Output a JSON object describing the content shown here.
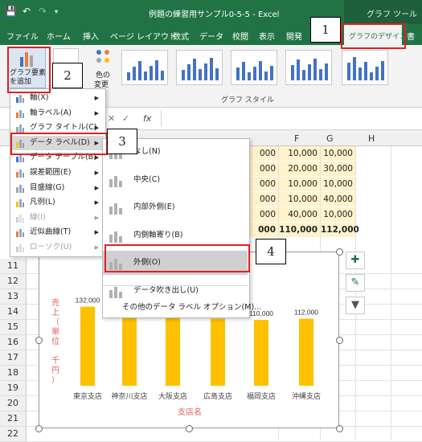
{
  "window": {
    "title": "例題の練習用サンプル0-5-5  -  Excel",
    "context_title": "グラフ ツール"
  },
  "ribbon": {
    "tabs": [
      "ファイル",
      "ホーム",
      "挿入",
      "ページ レイアウト",
      "数式",
      "データ",
      "校閲",
      "表示",
      "開発"
    ],
    "active_tab": "グラフのデザイン",
    "cut_tab": "書",
    "add_element_label_1": "グラフ要素",
    "add_element_label_2": "を追加",
    "color_label_1": "色の",
    "color_label_2": "変更",
    "group_label": "グラフ スタイル"
  },
  "formula_bar": {
    "fx": "fx"
  },
  "columns": [
    "F",
    "G",
    "H"
  ],
  "rows": [
    "11",
    "12",
    "13",
    "14",
    "15",
    "16",
    "17",
    "18",
    "19",
    "20",
    "21",
    "22"
  ],
  "table": {
    "e_col": [
      "000",
      "000",
      "000",
      "000",
      "000",
      "000"
    ],
    "f_col": [
      "10,000",
      "20,000",
      "10,000",
      "10,000",
      "40,000",
      "110,000"
    ],
    "g_col": [
      "10,000",
      "30,000",
      "10,000",
      "40,000",
      "10,000",
      "112,000"
    ]
  },
  "element_menu": {
    "items": [
      {
        "label": "軸(X)",
        "enabled": true
      },
      {
        "label": "軸ラベル(A)",
        "enabled": true
      },
      {
        "label": "グラフ タイトル(C)",
        "enabled": true
      },
      {
        "label": "データ ラベル(D)",
        "enabled": true
      },
      {
        "label": "データ テーブル(B)",
        "enabled": true
      },
      {
        "label": "誤差範囲(E)",
        "enabled": true
      },
      {
        "label": "目盛線(G)",
        "enabled": true
      },
      {
        "label": "凡例(L)",
        "enabled": true
      },
      {
        "label": "線(I)",
        "enabled": false
      },
      {
        "label": "近似曲線(T)",
        "enabled": true
      },
      {
        "label": "ローソク(U)",
        "enabled": false
      }
    ]
  },
  "data_label_submenu": {
    "items": [
      "なし(N)",
      "中央(C)",
      "内部外側(E)",
      "内側軸寄り(B)",
      "外側(O)",
      "データ吹き出し(U)"
    ],
    "more": "その他のデータ ラベル オプション(M)..."
  },
  "chart_data": {
    "type": "bar",
    "categories": [
      "東京支店",
      "神奈川支店",
      "大阪支店",
      "広島支店",
      "福岡支店",
      "沖縄支店"
    ],
    "values": [
      132000,
      150000,
      120000,
      112000,
      110000,
      112000
    ],
    "data_labels": [
      "132,000",
      "",
      "120,000",
      "112,000",
      "110,000",
      "112,000"
    ],
    "xlabel": "支店名",
    "ylabel": "売上（単位　千円）",
    "ylabel_chars": [
      "売",
      "上",
      "（",
      "単",
      "位",
      "",
      "千",
      "円",
      "）"
    ],
    "bar_color": "#ffc000",
    "label_color": "#e06060"
  },
  "callouts": [
    "1",
    "2",
    "3",
    "4"
  ],
  "colors": {
    "excel_green": "#217346",
    "highlight_red": "#e02020",
    "cell_fill": "#fff2cc"
  }
}
